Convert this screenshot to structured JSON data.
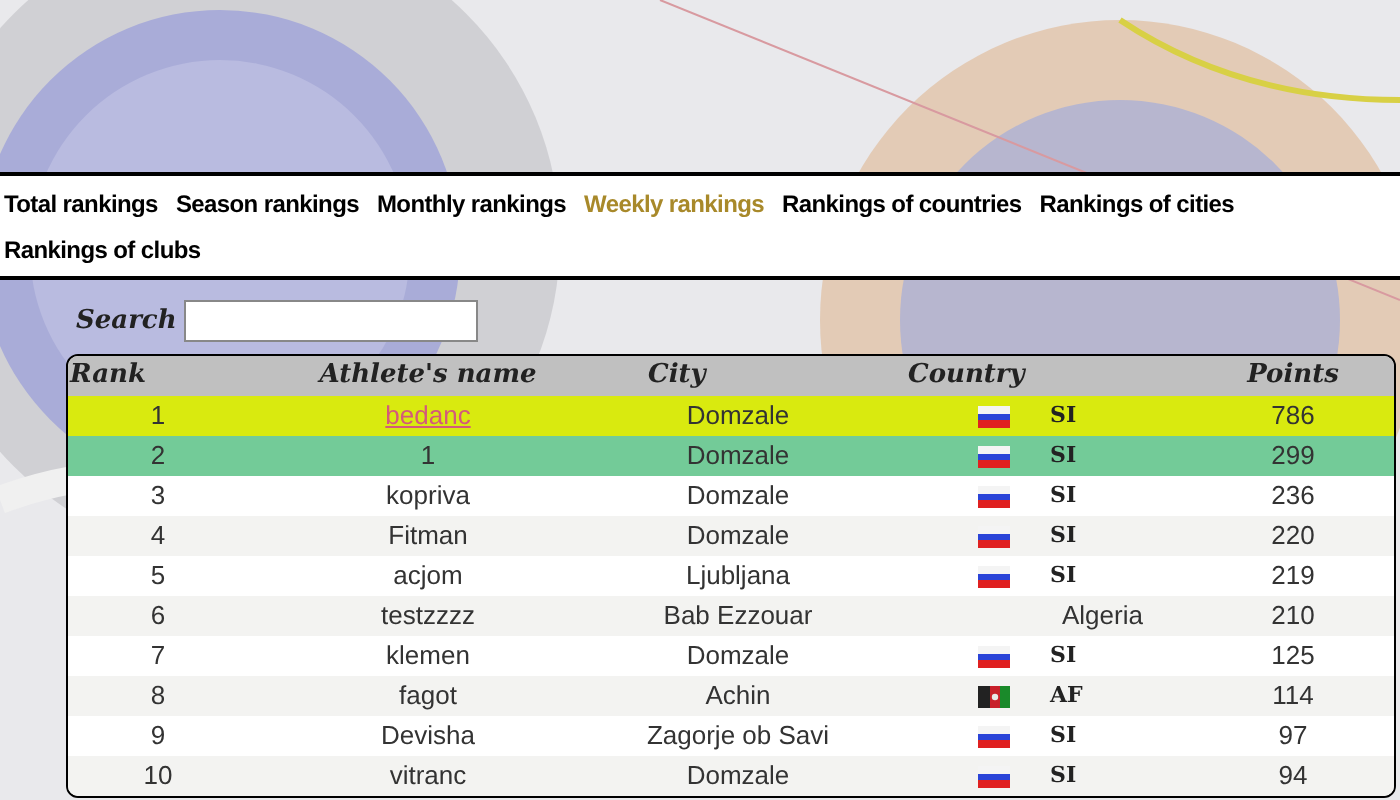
{
  "nav": [
    {
      "label": "Total rankings",
      "selected": false
    },
    {
      "label": "Season rankings",
      "selected": false
    },
    {
      "label": "Monthly rankings",
      "selected": false
    },
    {
      "label": "Weekly rankings",
      "selected": true
    },
    {
      "label": "Rankings of countries",
      "selected": false
    },
    {
      "label": "Rankings of cities",
      "selected": false
    },
    {
      "label": "Rankings of clubs",
      "selected": false
    }
  ],
  "search": {
    "label": "Search"
  },
  "table": {
    "columns": [
      "Rank",
      "Athlete's name",
      "City",
      "Country",
      "Points"
    ],
    "rows": [
      {
        "rank": "1",
        "name": "bedanc",
        "link": true,
        "kind": "leader",
        "city": "Domzale",
        "country": {
          "kind": "slovenia",
          "code": "SI"
        },
        "points": "786"
      },
      {
        "rank": "2",
        "name": "1",
        "link": false,
        "kind": "self",
        "city": "Domzale",
        "country": {
          "kind": "slovenia",
          "code": "SI"
        },
        "points": "299"
      },
      {
        "rank": "3",
        "name": "kopriva",
        "link": false,
        "kind": "normal",
        "city": "Domzale",
        "country": {
          "kind": "slovenia",
          "code": "SI"
        },
        "points": "236"
      },
      {
        "rank": "4",
        "name": "Fitman",
        "link": false,
        "kind": "normal",
        "city": "Domzale",
        "country": {
          "kind": "slovenia",
          "code": "SI"
        },
        "points": "220"
      },
      {
        "rank": "5",
        "name": "acjom",
        "link": false,
        "kind": "normal",
        "city": "Ljubljana",
        "country": {
          "kind": "slovenia",
          "code": "SI"
        },
        "points": "219"
      },
      {
        "rank": "6",
        "name": "testzzzz",
        "link": false,
        "kind": "normal",
        "city": "Bab Ezzouar",
        "country": {
          "kind": "name",
          "name": "Algeria"
        },
        "points": "210"
      },
      {
        "rank": "7",
        "name": "klemen",
        "link": false,
        "kind": "normal",
        "city": "Domzale",
        "country": {
          "kind": "slovenia",
          "code": "SI"
        },
        "points": "125"
      },
      {
        "rank": "8",
        "name": "fagot",
        "link": false,
        "kind": "normal",
        "city": "Achin",
        "country": {
          "kind": "afghanistan",
          "code": "AF"
        },
        "points": "114"
      },
      {
        "rank": "9",
        "name": "Devisha",
        "link": false,
        "kind": "normal",
        "city": "Zagorje ob Savi",
        "country": {
          "kind": "slovenia",
          "code": "SI"
        },
        "points": "97"
      },
      {
        "rank": "10",
        "name": "vitranc",
        "link": false,
        "kind": "normal",
        "city": "Domzale",
        "country": {
          "kind": "slovenia",
          "code": "SI"
        },
        "points": "94"
      }
    ]
  }
}
